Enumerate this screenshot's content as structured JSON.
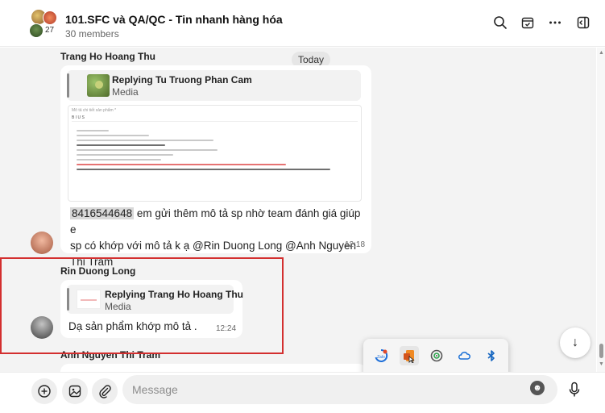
{
  "header": {
    "title": "101.SFC và QA/QC - Tin nhanh hàng hóa",
    "members": "30 members",
    "avatar_count": "27"
  },
  "chat": {
    "day_label": "Today",
    "messages": [
      {
        "sender": "Trang Ho Hoang Thu",
        "reply_to": "Replying Tu Truong Phan Cam",
        "reply_type": "Media",
        "image_label": "Mô tả chi tiết sản phẩm *",
        "image_toolbar": "B  I  U  S",
        "text_highlight": "8416544648",
        "text_line1": " em gửi thêm mô tả sp nhờ team đánh giá giúp e",
        "text_line2": "sp có khớp với mô tả  k ạ @Rin Duong Long @Anh Nguyen",
        "text_line3": "Thi Tram",
        "time": "12:18"
      },
      {
        "sender": "Rin Duong Long",
        "reply_to": "Replying Trang Ho Hoang Thu",
        "reply_type": "Media",
        "text": "Dạ sản phẩm khớp mô tả .",
        "time": "12:24"
      },
      {
        "sender": "Anh Nguyen Thi Tram"
      }
    ]
  },
  "composer": {
    "placeholder": "Message",
    "emoji_glyph": "☻"
  },
  "tray": {
    "icons": [
      "app-tile-icon",
      "office-icon",
      "headset-icon",
      "cloud-icon",
      "bluetooth-icon",
      "cloud-sync-icon",
      "security-shield-icon",
      "orange-app-icon"
    ]
  },
  "glyphs": {
    "search": "⌕",
    "more": "···",
    "down_arrow": "↓",
    "plus": "+",
    "clip": "⌇"
  }
}
